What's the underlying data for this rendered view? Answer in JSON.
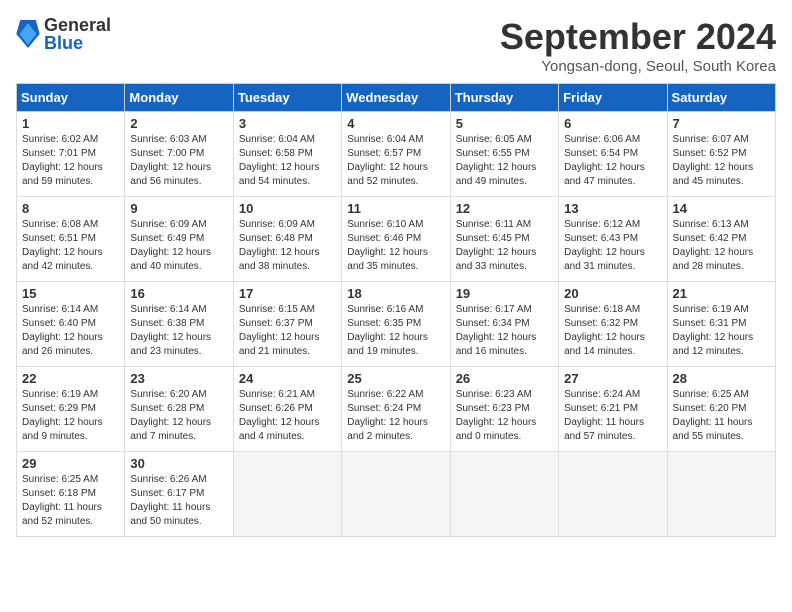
{
  "logo": {
    "general": "General",
    "blue": "Blue"
  },
  "title": "September 2024",
  "location": "Yongsan-dong, Seoul, South Korea",
  "headers": [
    "Sunday",
    "Monday",
    "Tuesday",
    "Wednesday",
    "Thursday",
    "Friday",
    "Saturday"
  ],
  "weeks": [
    [
      {
        "day": "1",
        "sunrise": "Sunrise: 6:02 AM",
        "sunset": "Sunset: 7:01 PM",
        "daylight": "Daylight: 12 hours and 59 minutes."
      },
      {
        "day": "2",
        "sunrise": "Sunrise: 6:03 AM",
        "sunset": "Sunset: 7:00 PM",
        "daylight": "Daylight: 12 hours and 56 minutes."
      },
      {
        "day": "3",
        "sunrise": "Sunrise: 6:04 AM",
        "sunset": "Sunset: 6:58 PM",
        "daylight": "Daylight: 12 hours and 54 minutes."
      },
      {
        "day": "4",
        "sunrise": "Sunrise: 6:04 AM",
        "sunset": "Sunset: 6:57 PM",
        "daylight": "Daylight: 12 hours and 52 minutes."
      },
      {
        "day": "5",
        "sunrise": "Sunrise: 6:05 AM",
        "sunset": "Sunset: 6:55 PM",
        "daylight": "Daylight: 12 hours and 49 minutes."
      },
      {
        "day": "6",
        "sunrise": "Sunrise: 6:06 AM",
        "sunset": "Sunset: 6:54 PM",
        "daylight": "Daylight: 12 hours and 47 minutes."
      },
      {
        "day": "7",
        "sunrise": "Sunrise: 6:07 AM",
        "sunset": "Sunset: 6:52 PM",
        "daylight": "Daylight: 12 hours and 45 minutes."
      }
    ],
    [
      {
        "day": "8",
        "sunrise": "Sunrise: 6:08 AM",
        "sunset": "Sunset: 6:51 PM",
        "daylight": "Daylight: 12 hours and 42 minutes."
      },
      {
        "day": "9",
        "sunrise": "Sunrise: 6:09 AM",
        "sunset": "Sunset: 6:49 PM",
        "daylight": "Daylight: 12 hours and 40 minutes."
      },
      {
        "day": "10",
        "sunrise": "Sunrise: 6:09 AM",
        "sunset": "Sunset: 6:48 PM",
        "daylight": "Daylight: 12 hours and 38 minutes."
      },
      {
        "day": "11",
        "sunrise": "Sunrise: 6:10 AM",
        "sunset": "Sunset: 6:46 PM",
        "daylight": "Daylight: 12 hours and 35 minutes."
      },
      {
        "day": "12",
        "sunrise": "Sunrise: 6:11 AM",
        "sunset": "Sunset: 6:45 PM",
        "daylight": "Daylight: 12 hours and 33 minutes."
      },
      {
        "day": "13",
        "sunrise": "Sunrise: 6:12 AM",
        "sunset": "Sunset: 6:43 PM",
        "daylight": "Daylight: 12 hours and 31 minutes."
      },
      {
        "day": "14",
        "sunrise": "Sunrise: 6:13 AM",
        "sunset": "Sunset: 6:42 PM",
        "daylight": "Daylight: 12 hours and 28 minutes."
      }
    ],
    [
      {
        "day": "15",
        "sunrise": "Sunrise: 6:14 AM",
        "sunset": "Sunset: 6:40 PM",
        "daylight": "Daylight: 12 hours and 26 minutes."
      },
      {
        "day": "16",
        "sunrise": "Sunrise: 6:14 AM",
        "sunset": "Sunset: 6:38 PM",
        "daylight": "Daylight: 12 hours and 23 minutes."
      },
      {
        "day": "17",
        "sunrise": "Sunrise: 6:15 AM",
        "sunset": "Sunset: 6:37 PM",
        "daylight": "Daylight: 12 hours and 21 minutes."
      },
      {
        "day": "18",
        "sunrise": "Sunrise: 6:16 AM",
        "sunset": "Sunset: 6:35 PM",
        "daylight": "Daylight: 12 hours and 19 minutes."
      },
      {
        "day": "19",
        "sunrise": "Sunrise: 6:17 AM",
        "sunset": "Sunset: 6:34 PM",
        "daylight": "Daylight: 12 hours and 16 minutes."
      },
      {
        "day": "20",
        "sunrise": "Sunrise: 6:18 AM",
        "sunset": "Sunset: 6:32 PM",
        "daylight": "Daylight: 12 hours and 14 minutes."
      },
      {
        "day": "21",
        "sunrise": "Sunrise: 6:19 AM",
        "sunset": "Sunset: 6:31 PM",
        "daylight": "Daylight: 12 hours and 12 minutes."
      }
    ],
    [
      {
        "day": "22",
        "sunrise": "Sunrise: 6:19 AM",
        "sunset": "Sunset: 6:29 PM",
        "daylight": "Daylight: 12 hours and 9 minutes."
      },
      {
        "day": "23",
        "sunrise": "Sunrise: 6:20 AM",
        "sunset": "Sunset: 6:28 PM",
        "daylight": "Daylight: 12 hours and 7 minutes."
      },
      {
        "day": "24",
        "sunrise": "Sunrise: 6:21 AM",
        "sunset": "Sunset: 6:26 PM",
        "daylight": "Daylight: 12 hours and 4 minutes."
      },
      {
        "day": "25",
        "sunrise": "Sunrise: 6:22 AM",
        "sunset": "Sunset: 6:24 PM",
        "daylight": "Daylight: 12 hours and 2 minutes."
      },
      {
        "day": "26",
        "sunrise": "Sunrise: 6:23 AM",
        "sunset": "Sunset: 6:23 PM",
        "daylight": "Daylight: 12 hours and 0 minutes."
      },
      {
        "day": "27",
        "sunrise": "Sunrise: 6:24 AM",
        "sunset": "Sunset: 6:21 PM",
        "daylight": "Daylight: 11 hours and 57 minutes."
      },
      {
        "day": "28",
        "sunrise": "Sunrise: 6:25 AM",
        "sunset": "Sunset: 6:20 PM",
        "daylight": "Daylight: 11 hours and 55 minutes."
      }
    ],
    [
      {
        "day": "29",
        "sunrise": "Sunrise: 6:25 AM",
        "sunset": "Sunset: 6:18 PM",
        "daylight": "Daylight: 11 hours and 52 minutes."
      },
      {
        "day": "30",
        "sunrise": "Sunrise: 6:26 AM",
        "sunset": "Sunset: 6:17 PM",
        "daylight": "Daylight: 11 hours and 50 minutes."
      },
      {
        "day": "",
        "sunrise": "",
        "sunset": "",
        "daylight": ""
      },
      {
        "day": "",
        "sunrise": "",
        "sunset": "",
        "daylight": ""
      },
      {
        "day": "",
        "sunrise": "",
        "sunset": "",
        "daylight": ""
      },
      {
        "day": "",
        "sunrise": "",
        "sunset": "",
        "daylight": ""
      },
      {
        "day": "",
        "sunrise": "",
        "sunset": "",
        "daylight": ""
      }
    ]
  ]
}
